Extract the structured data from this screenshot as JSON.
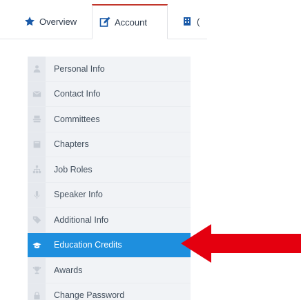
{
  "tabs": [
    {
      "label": "Overview",
      "icon": "star-icon",
      "active": false
    },
    {
      "label": "Account",
      "icon": "edit-icon",
      "active": true
    },
    {
      "label": "(",
      "icon": "building-icon",
      "active": false
    }
  ],
  "menu": {
    "items": [
      {
        "label": "Personal Info",
        "icon": "user-icon"
      },
      {
        "label": "Contact Info",
        "icon": "envelope-icon"
      },
      {
        "label": "Committees",
        "icon": "group-icon"
      },
      {
        "label": "Chapters",
        "icon": "book-icon"
      },
      {
        "label": "Job Roles",
        "icon": "sitemap-icon"
      },
      {
        "label": "Speaker Info",
        "icon": "microphone-icon"
      },
      {
        "label": "Additional Info",
        "icon": "tag-icon"
      },
      {
        "label": "Education Credits",
        "icon": "graduation-cap-icon",
        "active": true
      },
      {
        "label": "Awards",
        "icon": "trophy-icon"
      },
      {
        "label": "Change Password",
        "icon": "lock-icon"
      }
    ]
  },
  "colors": {
    "accent_blue": "#1e8fde",
    "tab_accent_red": "#c2362b",
    "annotation_arrow": "#e4000f",
    "tab_icon_blue": "#1a5aa8"
  }
}
